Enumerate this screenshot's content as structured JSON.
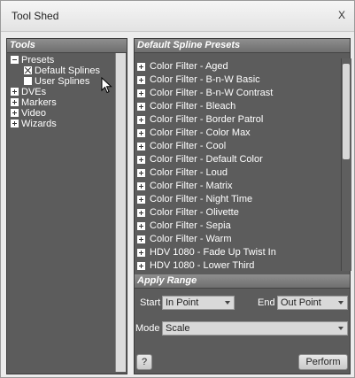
{
  "window": {
    "title": "Tool Shed",
    "close_label": "X"
  },
  "tools": {
    "header": "Tools",
    "tree": [
      {
        "label": "Presets",
        "kind": "collapse",
        "indent": 0
      },
      {
        "label": "Default Splines",
        "kind": "checked",
        "indent": 1
      },
      {
        "label": "User Splines",
        "kind": "check",
        "indent": 1
      },
      {
        "label": "DVEs",
        "kind": "expand",
        "indent": 0
      },
      {
        "label": "Markers",
        "kind": "expand",
        "indent": 0
      },
      {
        "label": "Video",
        "kind": "expand",
        "indent": 0
      },
      {
        "label": "Wizards",
        "kind": "expand",
        "indent": 0
      }
    ]
  },
  "presets": {
    "header": "Default Spline Presets",
    "items": [
      "Color Filter - Aged",
      "Color Filter - B-n-W Basic",
      "Color Filter - B-n-W Contrast",
      "Color Filter - Bleach",
      "Color Filter - Border Patrol",
      "Color Filter - Color Max",
      "Color Filter - Cool",
      "Color Filter - Default Color",
      "Color Filter - Loud",
      "Color Filter - Matrix",
      "Color Filter - Night Time",
      "Color Filter - Olivette",
      "Color Filter - Sepia",
      "Color Filter - Warm",
      "HDV 1080 - Fade Up Twist In",
      "HDV 1080 - Lower Third"
    ]
  },
  "apply_range": {
    "header": "Apply Range",
    "start_label": "Start",
    "start_value": "In Point",
    "end_label": "End",
    "end_value": "Out Point",
    "mode_label": "Mode",
    "mode_value": "Scale",
    "help_label": "?",
    "perform_label": "Perform"
  }
}
